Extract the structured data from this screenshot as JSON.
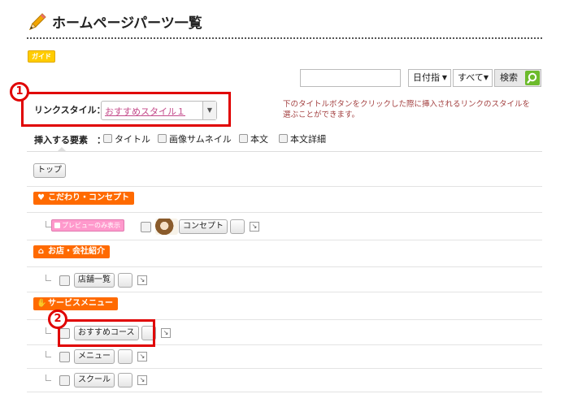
{
  "header": {
    "title": "ホームページパーツ一覧",
    "guide_label": "ガイド"
  },
  "search": {
    "date_select": "日付指",
    "all_select": "すべて",
    "button_label": "検索"
  },
  "link_style": {
    "label": "リンクスタイル：",
    "value": "おすすめスタイル１",
    "description": "下のタイトルボタンをクリックした際に挿入されるリンクのスタイルを選ぶことができます。"
  },
  "insert_elements": {
    "label": "挿入する要素　：",
    "options": [
      "タイトル",
      "画像サムネイル",
      "本文",
      "本文詳細"
    ]
  },
  "top_button": "トップ",
  "sections": [
    {
      "title": "こだわり・コンセプト",
      "preview_badge": "プレビューのみ表示",
      "items": [
        "コンセプト"
      ]
    },
    {
      "title": "お店・会社紹介",
      "items": [
        "店舗一覧"
      ]
    },
    {
      "title": "サービスメニュー",
      "items": [
        "おすすめコース",
        "メニュー",
        "スクール"
      ]
    }
  ],
  "callouts": [
    "1",
    "2"
  ],
  "colors": {
    "accent": "#ff6a00",
    "callout": "#e00000",
    "pink": "#ff99cc",
    "search_green": "#6dbb2c"
  }
}
